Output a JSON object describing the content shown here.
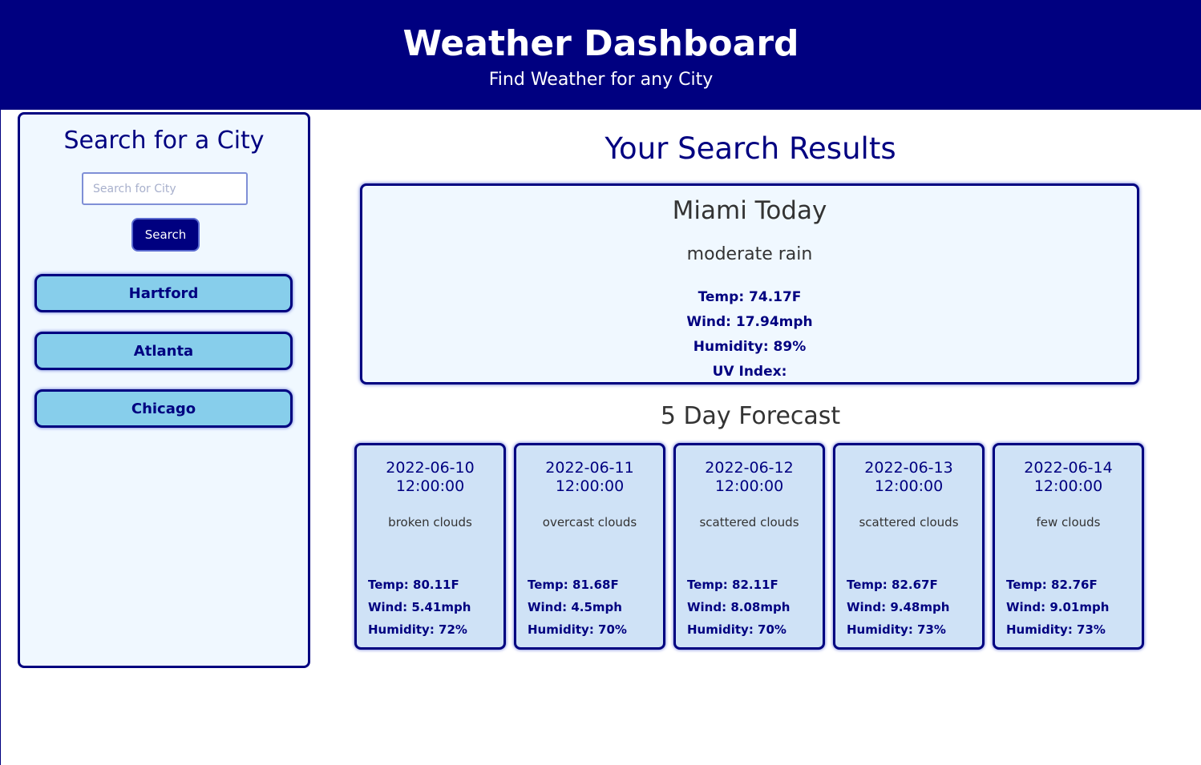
{
  "header": {
    "title": "Weather Dashboard",
    "subtitle": "Find Weather for any City"
  },
  "sidebar": {
    "title": "Search for a City",
    "search_placeholder": "Search for City",
    "search_value": "",
    "search_button": "Search",
    "history": [
      "Hartford",
      "Atlanta",
      "Chicago"
    ]
  },
  "results": {
    "title": "Your Search Results",
    "today": {
      "heading": "Miami Today",
      "description": "moderate rain",
      "temp": "Temp: 74.17F",
      "wind": "Wind: 17.94mph",
      "humidity": "Humidity: 89%",
      "uv": "UV Index:"
    },
    "forecast_title": "5 Day Forecast",
    "forecast": [
      {
        "date": "2022-06-10",
        "time": "12:00:00",
        "description": "broken clouds",
        "temp": "Temp: 80.11F",
        "wind": "Wind: 5.41mph",
        "humidity": "Humidity: 72%"
      },
      {
        "date": "2022-06-11",
        "time": "12:00:00",
        "description": "overcast clouds",
        "temp": "Temp: 81.68F",
        "wind": "Wind: 4.5mph",
        "humidity": "Humidity: 70%"
      },
      {
        "date": "2022-06-12",
        "time": "12:00:00",
        "description": "scattered clouds",
        "temp": "Temp: 82.11F",
        "wind": "Wind: 8.08mph",
        "humidity": "Humidity: 70%"
      },
      {
        "date": "2022-06-13",
        "time": "12:00:00",
        "description": "scattered clouds",
        "temp": "Temp: 82.67F",
        "wind": "Wind: 9.48mph",
        "humidity": "Humidity: 73%"
      },
      {
        "date": "2022-06-14",
        "time": "12:00:00",
        "description": "few clouds",
        "temp": "Temp: 82.76F",
        "wind": "Wind: 9.01mph",
        "humidity": "Humidity: 73%"
      }
    ]
  },
  "colors": {
    "primary": "#000080",
    "panel_bg": "#f0f8ff",
    "city_button_bg": "#87ceeb",
    "forecast_card_bg": "#cfe2f6"
  }
}
